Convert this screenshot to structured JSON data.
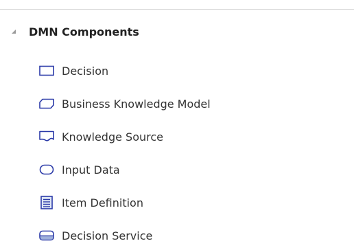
{
  "toolbox": {
    "group": {
      "title": "DMN Components",
      "expanded": true
    },
    "items": [
      {
        "label": "Decision",
        "icon": "decision-icon"
      },
      {
        "label": "Business Knowledge Model",
        "icon": "business-knowledge-model-icon"
      },
      {
        "label": "Knowledge Source",
        "icon": "knowledge-source-icon"
      },
      {
        "label": "Input Data",
        "icon": "input-data-icon"
      },
      {
        "label": "Item Definition",
        "icon": "item-definition-icon"
      },
      {
        "label": "Decision Service",
        "icon": "decision-service-icon"
      }
    ],
    "colors": {
      "icon_stroke": "#2b3aa8",
      "icon_fill_light": "#dfe7f5",
      "header_text": "#222222",
      "item_text": "#333333"
    }
  }
}
